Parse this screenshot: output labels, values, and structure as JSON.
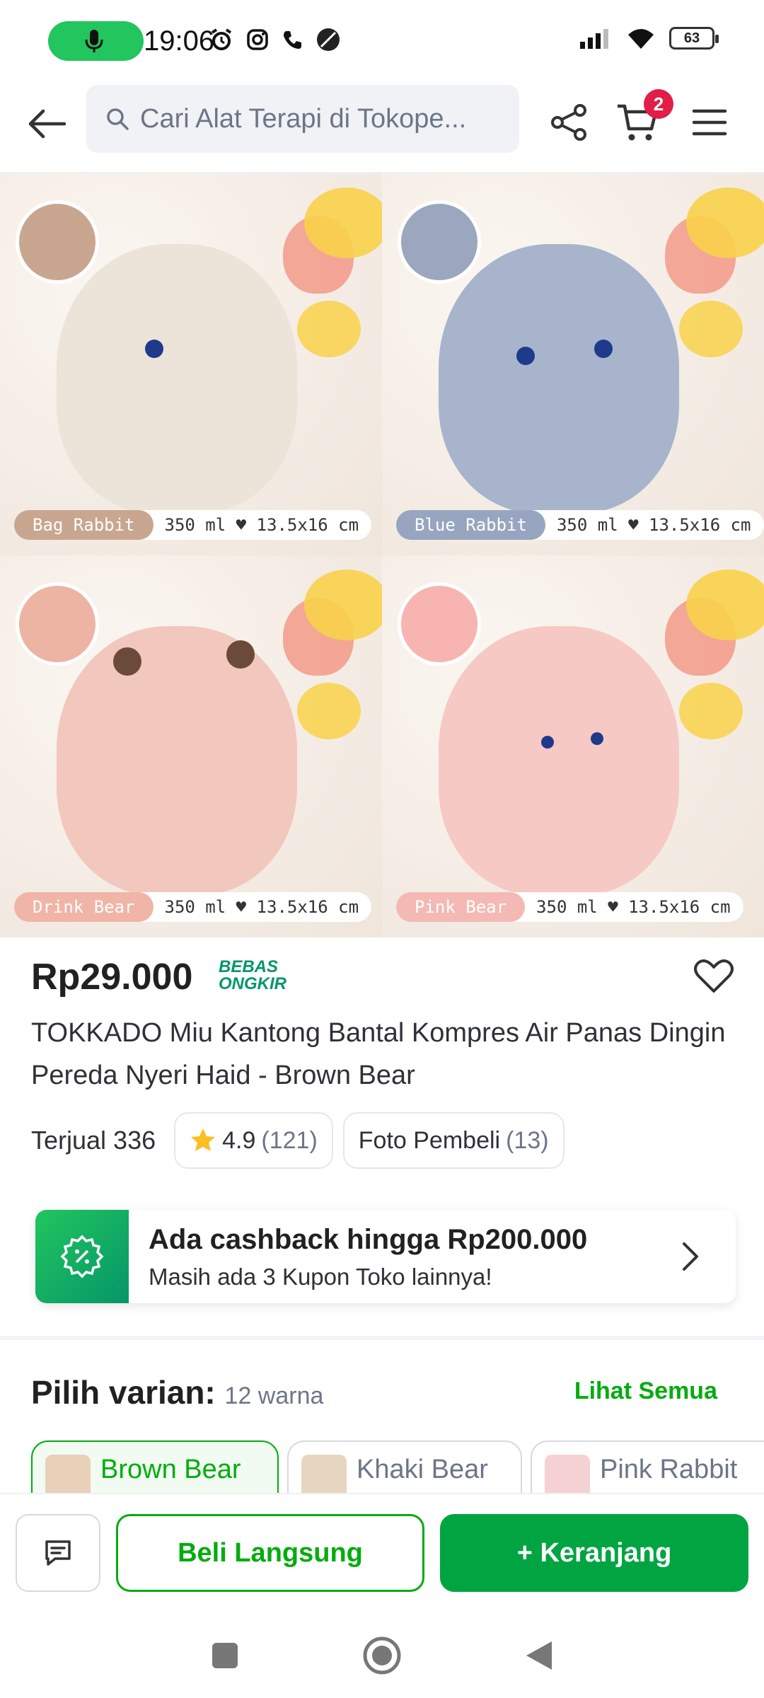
{
  "status_bar": {
    "time": "19:06",
    "battery": "63"
  },
  "nav": {
    "search_placeholder": "Cari Alat Terapi di Tokope...",
    "cart_count": "2"
  },
  "product_images": [
    {
      "name": "Bag Rabbit",
      "spec": "350 ml ♥ 13.5x16 cm",
      "swatch_color": "#c9a68f",
      "body_color": "#ece3d9",
      "label_color": "#c9a68f"
    },
    {
      "name": "Blue Rabbit",
      "spec": "350 ml ♥ 13.5x16 cm",
      "swatch_color": "#9aa7bf",
      "body_color": "#a7b4cc",
      "label_color": "#97a5c0"
    },
    {
      "name": "Drink Bear",
      "spec": "350 ml ♥ 13.5x16 cm",
      "swatch_color": "#edb3a3",
      "body_color": "#f2c7bd",
      "label_color": "#f0b5a6"
    },
    {
      "name": "Pink Bear",
      "spec": "350 ml ♥ 13.5x16 cm",
      "swatch_color": "#f7b4b0",
      "body_color": "#f6c9c5",
      "label_color": "#f4b9b4"
    }
  ],
  "product": {
    "price": "Rp29.000",
    "free_shipping_line1": "BEBAS",
    "free_shipping_line2": "ONGKIR",
    "title": "TOKKADO Miu Kantong Bantal Kompres Air Panas Dingin Pereda Nyeri Haid - Brown Bear",
    "sold": "Terjual 336",
    "rating": "4.9",
    "rating_count": "(121)",
    "buyer_photos_label": "Foto Pembeli",
    "buyer_photos_count": "(13)"
  },
  "cashback": {
    "title": "Ada cashback hingga Rp200.000",
    "subtitle": "Masih ada 3 Kupon Toko lainnya!"
  },
  "variant": {
    "title": "Pilih varian:",
    "count": "12 warna",
    "see_all": "Lihat Semua",
    "options": [
      {
        "label": "Brown Bear",
        "selected": true
      },
      {
        "label": "Khaki Bear",
        "selected": false
      },
      {
        "label": "Pink Rabbit",
        "selected": false
      }
    ]
  },
  "actions": {
    "buy_now": "Beli Langsung",
    "add_to_cart": "+ Keranjang"
  },
  "colors": {
    "accent_green": "#03ac0e",
    "cart_badge": "#e11d48"
  }
}
